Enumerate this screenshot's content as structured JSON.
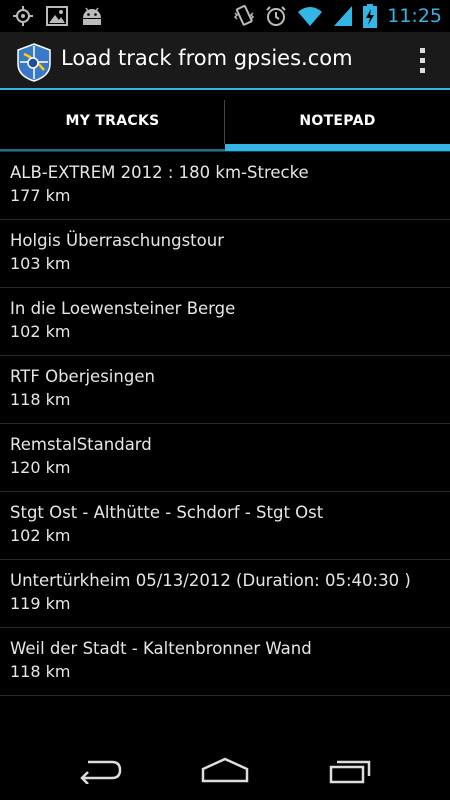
{
  "status_bar": {
    "time": "11:25",
    "left_icons": [
      "gps-icon",
      "image-icon",
      "android-icon"
    ],
    "right_icons": [
      "vibrate-icon",
      "alarm-icon",
      "wifi-icon",
      "signal-icon",
      "battery-charging-icon"
    ]
  },
  "action_bar": {
    "title": "Load track from gpsies.com",
    "app_icon": "gpsies-app-icon",
    "overflow_icon": "overflow-menu-icon"
  },
  "tabs": [
    {
      "label": "MY TRACKS",
      "selected": false
    },
    {
      "label": "NOTEPAD",
      "selected": true
    }
  ],
  "tracks": [
    {
      "name": "ALB-EXTREM 2012 : 180 km-Strecke",
      "distance": "177 km"
    },
    {
      "name": "Holgis Überraschungstour",
      "distance": "103 km"
    },
    {
      "name": "In die Loewensteiner Berge",
      "distance": "102 km"
    },
    {
      "name": "RTF Oberjesingen",
      "distance": "118 km"
    },
    {
      "name": "RemstalStandard",
      "distance": "120 km"
    },
    {
      "name": "Stgt Ost - Althütte - Schdorf - Stgt Ost",
      "distance": "102 km"
    },
    {
      "name": "Untertürkheim 05/13/2012 (Duration: 05:40:30 )",
      "distance": "119 km"
    },
    {
      "name": "Weil der Stadt - Kaltenbronner Wand",
      "distance": "118 km"
    }
  ],
  "nav_bar": {
    "icons": [
      "back-icon",
      "home-icon",
      "recent-apps-icon"
    ]
  },
  "colors": {
    "accent": "#33b5e5",
    "background": "#000000",
    "action_bar": "#1a1a1a"
  }
}
